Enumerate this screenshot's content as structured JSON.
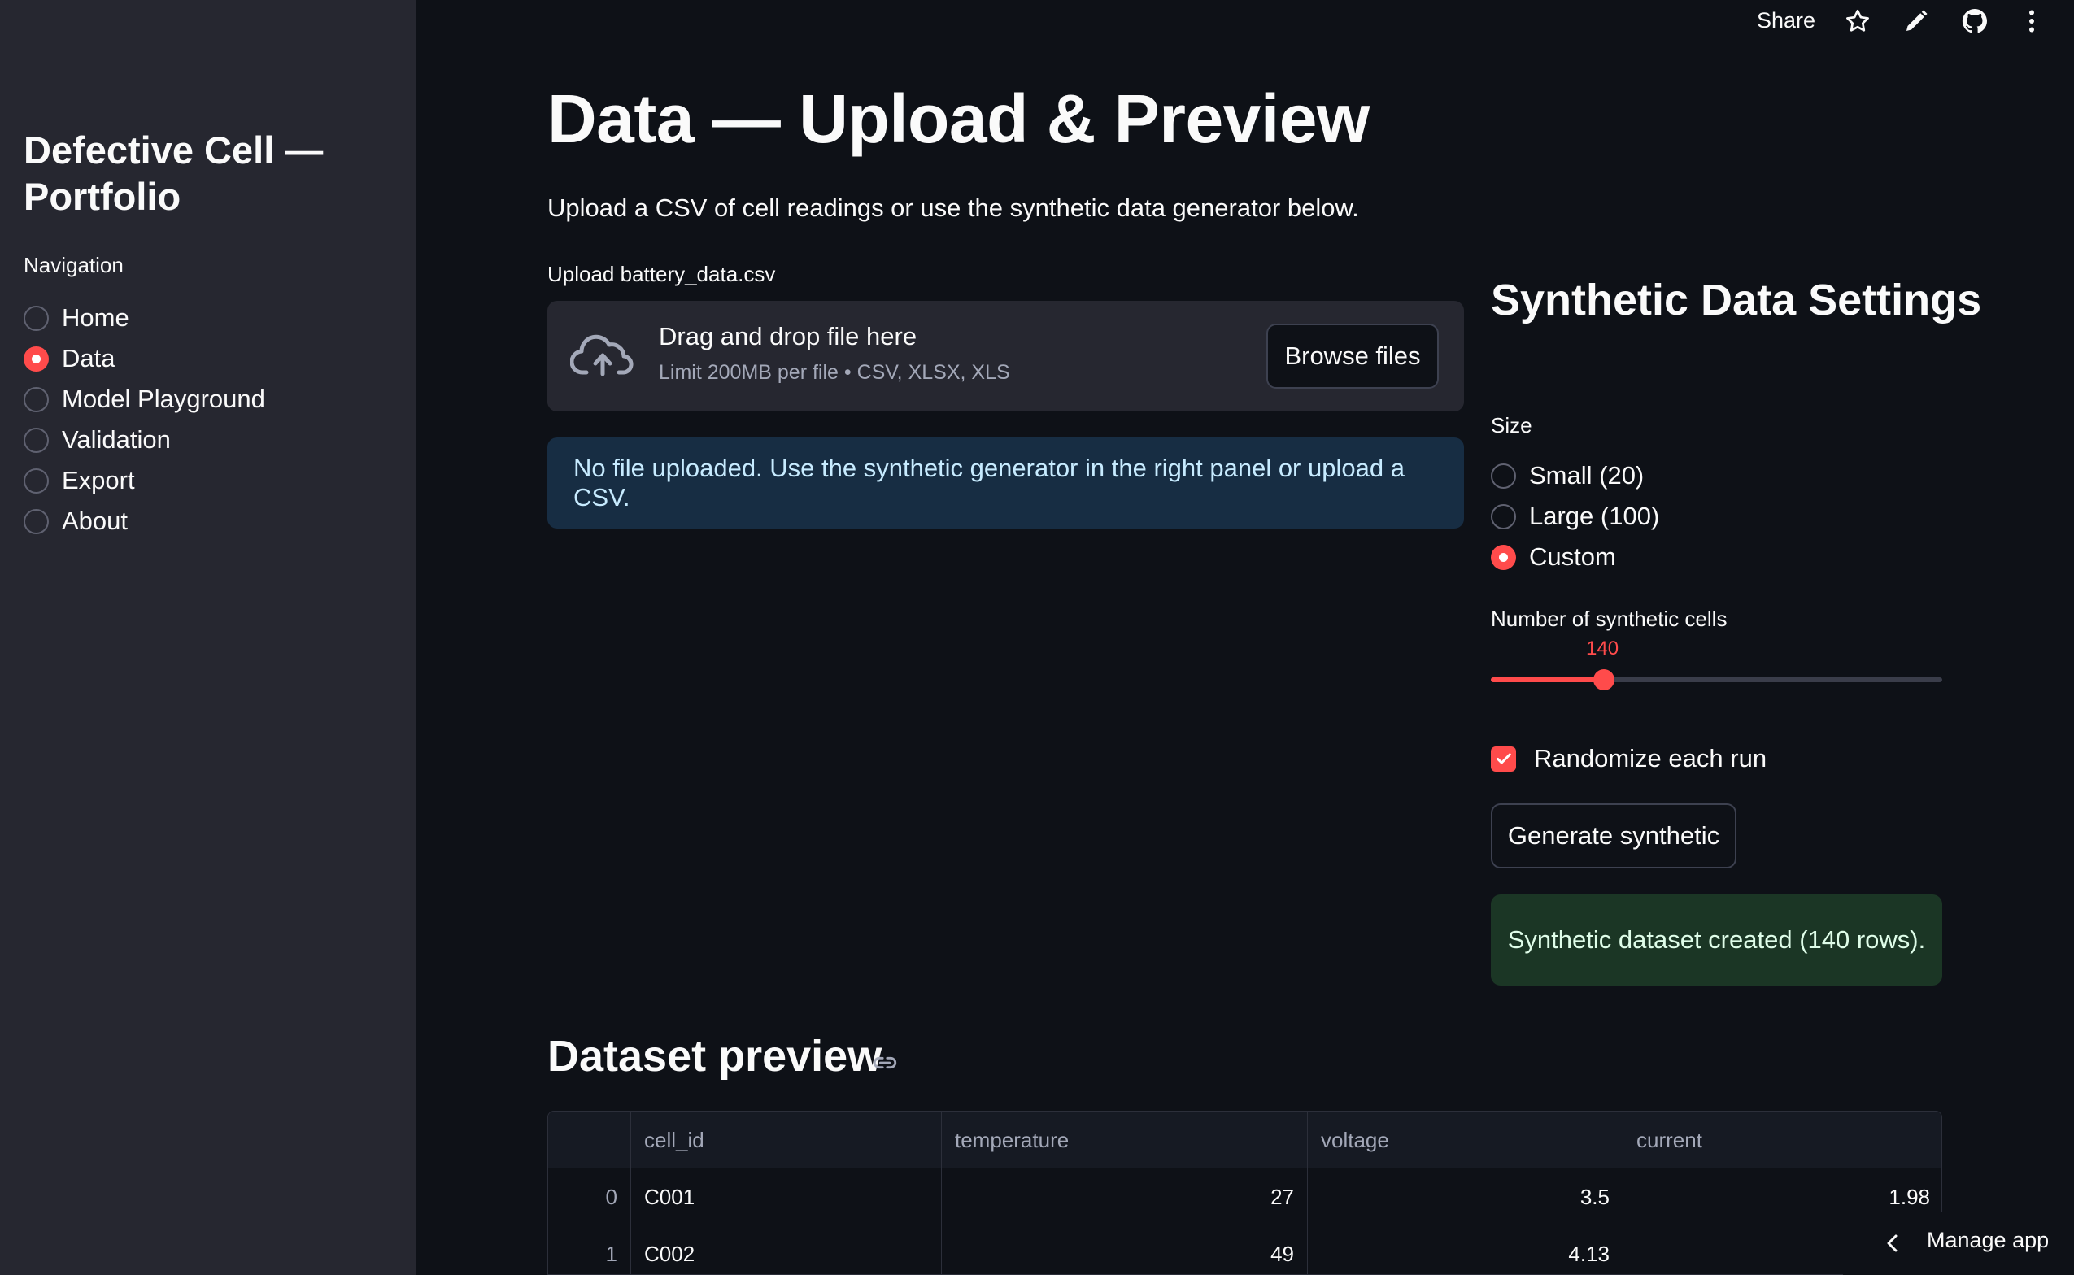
{
  "header": {
    "share_label": "Share",
    "icons": [
      "star-icon",
      "pencil-icon",
      "github-icon",
      "more-vertical-icon"
    ]
  },
  "sidebar": {
    "title": "Defective Cell — Portfolio",
    "nav_label": "Navigation",
    "items": [
      {
        "label": "Home",
        "selected": false
      },
      {
        "label": "Data",
        "selected": true
      },
      {
        "label": "Model Playground",
        "selected": false
      },
      {
        "label": "Validation",
        "selected": false
      },
      {
        "label": "Export",
        "selected": false
      },
      {
        "label": "About",
        "selected": false
      }
    ]
  },
  "main": {
    "title": "Data — Upload & Preview",
    "intro": "Upload a CSV of cell readings or use the synthetic data generator below.",
    "upload": {
      "label": "Upload battery_data.csv",
      "dropzone_title": "Drag and drop file here",
      "dropzone_subtitle": "Limit 200MB per file • CSV, XLSX, XLS",
      "browse_label": "Browse files"
    },
    "info_message": "No file uploaded. Use the synthetic generator in the right panel or upload a CSV."
  },
  "synthetic": {
    "title": "Synthetic Data Settings",
    "size_label": "Size",
    "size_options": [
      {
        "label": "Small (20)",
        "selected": false
      },
      {
        "label": "Large (100)",
        "selected": false
      },
      {
        "label": "Custom",
        "selected": true
      }
    ],
    "num_cells_label": "Number of synthetic cells",
    "num_cells_value": "140",
    "slider_fraction": 0.25,
    "randomize_label": "Randomize each run",
    "randomize_checked": true,
    "generate_label": "Generate synthetic",
    "success_message": "Synthetic dataset created (140 rows)."
  },
  "preview": {
    "title": "Dataset preview",
    "columns": [
      "",
      "cell_id",
      "temperature",
      "voltage",
      "current"
    ],
    "rows": [
      [
        "0",
        "C001",
        "27",
        "3.5",
        "1.98"
      ],
      [
        "1",
        "C002",
        "49",
        "4.13",
        ""
      ]
    ]
  },
  "manage_app_label": "Manage app",
  "colors": {
    "accent": "#ff4b4b",
    "sidebar_bg": "#262730",
    "main_bg": "#0e1117",
    "info_bg": "#172d43",
    "success_bg": "#1b3625"
  }
}
